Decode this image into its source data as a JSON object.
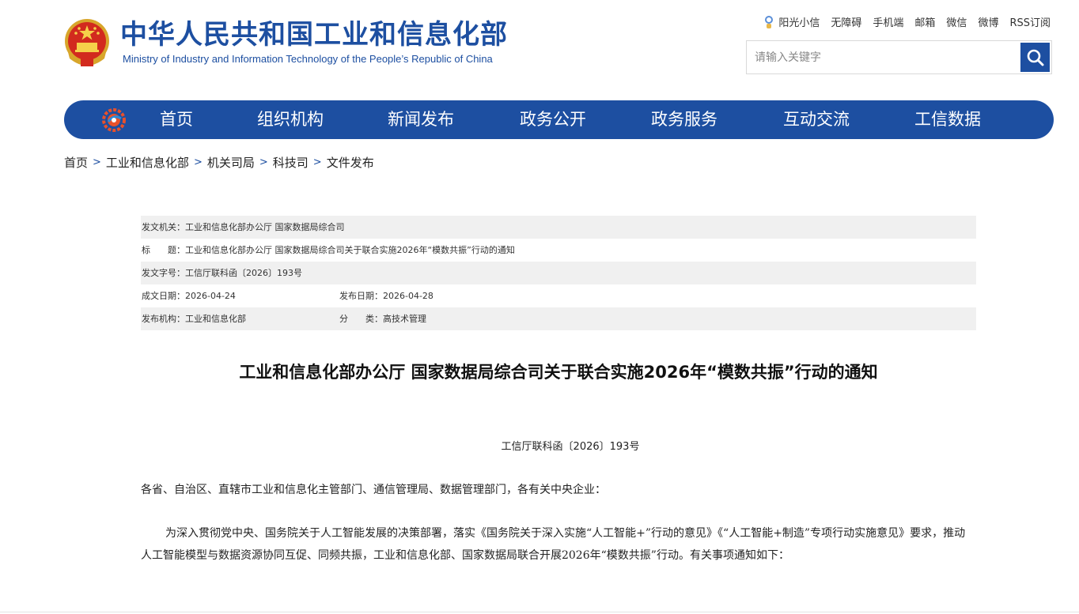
{
  "header": {
    "title": "中华人民共和国工业和信息化部",
    "subtitle": "Ministry of Industry and Information Technology of the People’s Republic of China",
    "emblem_icon": "national-emblem-icon",
    "brand_color": "#1d4fa1"
  },
  "toplinks": {
    "sunshine": "阳光小信",
    "accessibility": "无障碍",
    "mobile": "手机端",
    "mail": "邮箱",
    "wechat": "微信",
    "weibo": "微博",
    "rss": "RSS订阅"
  },
  "search": {
    "placeholder": "请输入关键字",
    "value": "",
    "icon": "search-icon"
  },
  "nav": {
    "items": [
      {
        "label": "首页"
      },
      {
        "label": "组织机构"
      },
      {
        "label": "新闻发布"
      },
      {
        "label": "政务公开"
      },
      {
        "label": "政务服务"
      },
      {
        "label": "互动交流"
      },
      {
        "label": "工信数据"
      }
    ]
  },
  "breadcrumb": {
    "items": [
      "首页",
      "工业和信息化部",
      "机关司局",
      "科技司",
      "文件发布"
    ],
    "separator": ">"
  },
  "meta": {
    "issuer": "发文机关：工业和信息化部办公厅 国家数据局综合司",
    "title": "标　　题：工业和信息化部办公厅 国家数据局综合司关于联合实施2026年“模数共振”行动的通知",
    "doc_no": "发文字号：工信厅联科函〔2026〕193号",
    "written_date": "成文日期：2026-04-24",
    "publish_date": "发布日期：2026-04-28",
    "publisher": "发布机构：工业和信息化部",
    "category": "分　　类：高技术管理"
  },
  "article": {
    "title": "工业和信息化部办公厅 国家数据局综合司关于联合实施2026年“模数共振”行动的通知",
    "doc_number": "工信厅联科函〔2026〕193号",
    "salutation": "各省、自治区、直辖市工业和信息化主管部门、通信管理局、数据管理部门，各有关中央企业：",
    "paragraph1": "为深入贯彻党中央、国务院关于人工智能发展的决策部署，落实《国务院关于深入实施“人工智能+”行动的意见》《“人工智能+制造”专项行动实施意见》要求，推动人工智能模型与数据资源协同互促、同频共振，工业和信息化部、国家数据局联合开展2026年“模数共振”行动。有关事项通知如下："
  }
}
